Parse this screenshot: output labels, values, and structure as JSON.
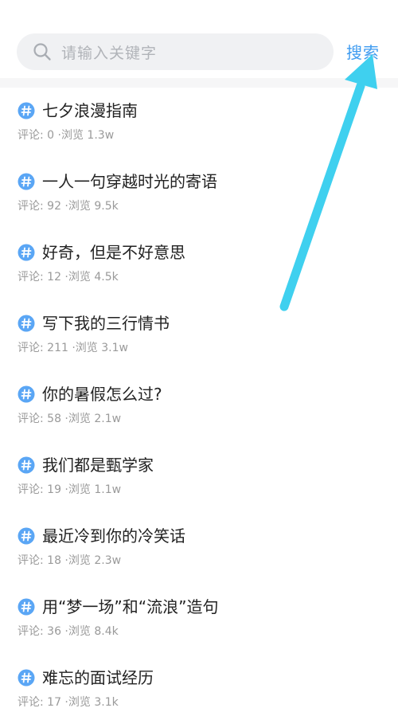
{
  "search": {
    "placeholder": "请输入关键字",
    "button_label": "搜索"
  },
  "colors": {
    "accent": "#3e9bf0",
    "annotation_arrow": "#3fd0ef",
    "hash_icon": "#5aa6f5"
  },
  "topics": [
    {
      "title": "七夕浪漫指南",
      "meta": "评论: 0 ·浏览 1.3w"
    },
    {
      "title": "一人一句穿越时光的寄语",
      "meta": "评论: 92 ·浏览 9.5k"
    },
    {
      "title": "好奇，但是不好意思",
      "meta": "评论: 12 ·浏览 4.5k"
    },
    {
      "title": "写下我的三行情书",
      "meta": "评论: 211 ·浏览 3.1w"
    },
    {
      "title": "你的暑假怎么过?",
      "meta": "评论: 58 ·浏览 2.1w"
    },
    {
      "title": "我们都是甄学家",
      "meta": "评论: 19 ·浏览 1.1w"
    },
    {
      "title": "最近冷到你的冷笑话",
      "meta": "评论: 18 ·浏览 2.3w"
    },
    {
      "title": "用“梦一场”和“流浪”造句",
      "meta": "评论: 36 ·浏览 8.4k"
    },
    {
      "title": "难忘的面试经历",
      "meta": "评论: 17 ·浏览 3.1k"
    }
  ]
}
